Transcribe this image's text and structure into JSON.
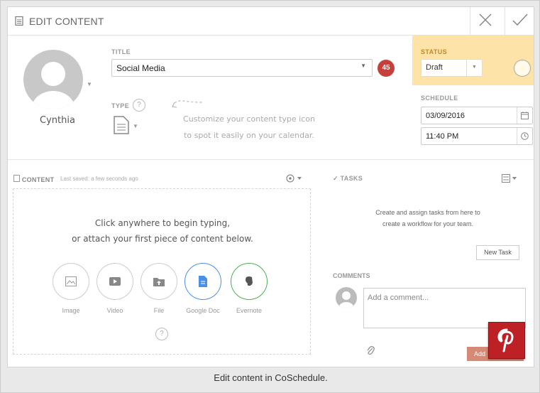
{
  "header": {
    "title": "EDIT CONTENT"
  },
  "author": {
    "name": "Cynthia"
  },
  "title_field": {
    "label": "TITLE",
    "value": "Social Media",
    "char_count": "45"
  },
  "type_field": {
    "label": "TYPE",
    "help": "?",
    "hint_line1": "Customize your content type icon",
    "hint_line2": "to spot it easily on your calendar."
  },
  "status": {
    "label": "STATUS",
    "value": "Draft",
    "color": "#fde3a7"
  },
  "schedule": {
    "label": "SCHEDULE",
    "date": "03/09/2016",
    "time": "11:40 PM"
  },
  "content": {
    "label": "CONTENT",
    "saved": "Last saved: a few seconds ago",
    "prompt_line1": "Click anywhere to begin typing,",
    "prompt_line2": "or attach your first piece of content below.",
    "help": "?",
    "attachments": [
      {
        "label": "Image",
        "icon": "image-icon"
      },
      {
        "label": "Video",
        "icon": "video-icon"
      },
      {
        "label": "File",
        "icon": "file-upload-icon"
      },
      {
        "label": "Google Doc",
        "icon": "google-doc-icon"
      },
      {
        "label": "Evernote",
        "icon": "evernote-icon"
      }
    ]
  },
  "tasks": {
    "label": "TASKS",
    "empty_line1": "Create and assign tasks from here to",
    "empty_line2": "create a workflow for your team.",
    "new_task": "New Task"
  },
  "comments": {
    "label": "COMMENTS",
    "placeholder": "Add a comment...",
    "add_button": "Add"
  },
  "caption": "Edit content in CoSchedule.",
  "colors": {
    "count_badge": "#c5403a",
    "pinterest": "#bd2126",
    "google_doc": "#4a8fe8",
    "evernote": "#4caf50"
  }
}
